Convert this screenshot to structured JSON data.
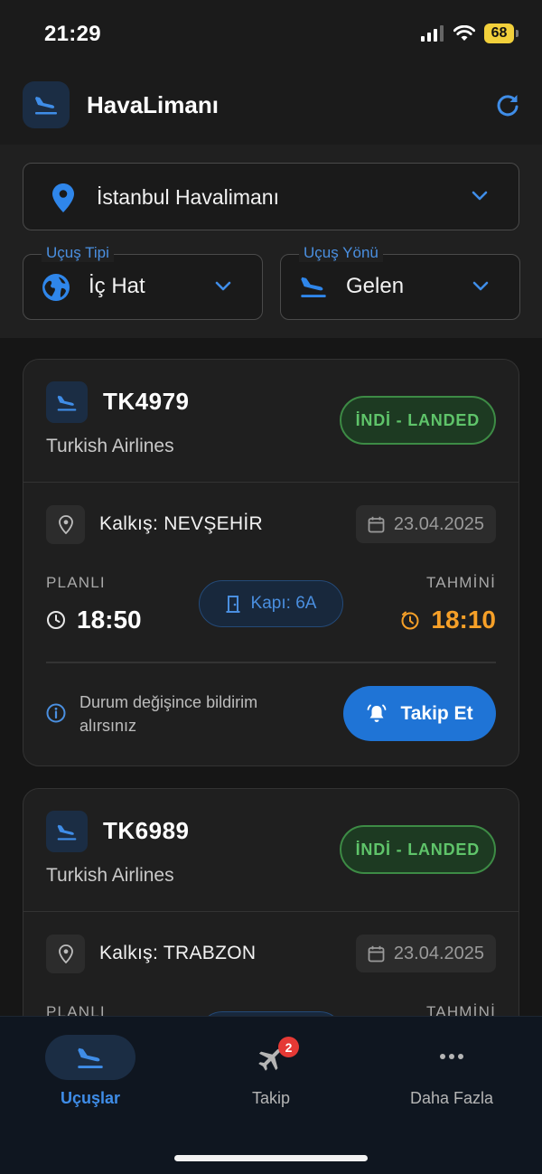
{
  "status_bar": {
    "time": "21:29",
    "battery": "68"
  },
  "header": {
    "title": "HavaLimanı"
  },
  "filters": {
    "airport": "İstanbul Havalimanı",
    "flight_type": {
      "label": "Uçuş Tipi",
      "value": "İç Hat"
    },
    "flight_direction": {
      "label": "Uçuş Yönü",
      "value": "Gelen"
    }
  },
  "flights": [
    {
      "code": "TK4979",
      "airline": "Turkish Airlines",
      "status": "İNDİ - LANDED",
      "departure": "Kalkış: NEVŞEHİR",
      "date": "23.04.2025",
      "planned_label": "PLANLI",
      "planned_time": "18:50",
      "gate": "Kapı: 6A",
      "estimated_label": "TAHMİNİ",
      "estimated_time": "18:10",
      "info": "Durum değişince bildirim alırsınız",
      "follow_label": "Takip Et"
    },
    {
      "code": "TK6989",
      "airline": "Turkish Airlines",
      "status": "İNDİ - LANDED",
      "departure": "Kalkış: TRABZON",
      "date": "23.04.2025",
      "planned_label": "PLANLI",
      "estimated_label": "TAHMİNİ"
    }
  ],
  "tabs": [
    {
      "label": "Uçuşlar",
      "icon": "plane-landing-icon",
      "active": true
    },
    {
      "label": "Takip",
      "icon": "airplane-icon",
      "badge": "2"
    },
    {
      "label": "Daha Fazla",
      "icon": "more-dots-icon"
    }
  ],
  "colors": {
    "accent": "#1f74d6",
    "landed": "#5fc46a",
    "estimated": "#f6a028",
    "background": "#161616"
  }
}
